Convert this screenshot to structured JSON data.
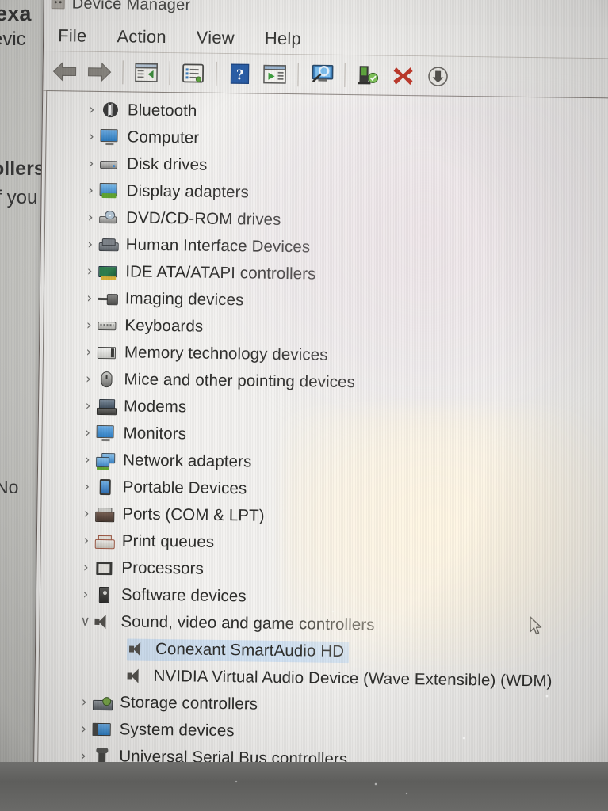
{
  "window": {
    "title": "Device Manager",
    "app_icon": "device-manager-icon"
  },
  "menubar": {
    "items": [
      {
        "label": "File",
        "name": "menu-file"
      },
      {
        "label": "Action",
        "name": "menu-action"
      },
      {
        "label": "View",
        "name": "menu-view"
      },
      {
        "label": "Help",
        "name": "menu-help"
      }
    ]
  },
  "toolbar": {
    "buttons": [
      {
        "name": "back-button",
        "icon": "back-arrow-icon",
        "tooltip": "Back"
      },
      {
        "name": "forward-button",
        "icon": "forward-arrow-icon",
        "tooltip": "Forward"
      },
      {
        "name": "show-hide-console-tree-button",
        "icon": "console-tree-icon",
        "tooltip": "Show/Hide Console Tree"
      },
      {
        "name": "properties-button",
        "icon": "properties-icon",
        "tooltip": "Properties"
      },
      {
        "name": "help-button",
        "icon": "help-question-icon",
        "tooltip": "Help"
      },
      {
        "name": "update-driver-button",
        "icon": "update-driver-icon",
        "tooltip": "Update Driver Software"
      },
      {
        "name": "scan-hardware-button",
        "icon": "scan-hardware-changes-icon",
        "tooltip": "Scan for hardware changes"
      },
      {
        "name": "enable-device-button",
        "icon": "enable-device-icon",
        "tooltip": "Enable device"
      },
      {
        "name": "uninstall-device-button",
        "icon": "uninstall-red-x-icon",
        "tooltip": "Uninstall device"
      },
      {
        "name": "disable-device-button",
        "icon": "disable-device-down-arrow-icon",
        "tooltip": "Disable device"
      }
    ]
  },
  "tree": {
    "selected": "Conexant SmartAudio HD",
    "nodes": [
      {
        "label": "Bluetooth",
        "icon": "bluetooth-icon",
        "state": "collapsed",
        "level": 1
      },
      {
        "label": "Computer",
        "icon": "computer-icon",
        "state": "collapsed",
        "level": 1
      },
      {
        "label": "Disk drives",
        "icon": "disk-drive-icon",
        "state": "collapsed",
        "level": 1
      },
      {
        "label": "Display adapters",
        "icon": "display-adapter-icon",
        "state": "collapsed",
        "level": 1
      },
      {
        "label": "DVD/CD-ROM drives",
        "icon": "dvd-drive-icon",
        "state": "collapsed",
        "level": 1
      },
      {
        "label": "Human Interface Devices",
        "icon": "hid-icon",
        "state": "collapsed",
        "level": 1
      },
      {
        "label": "IDE ATA/ATAPI controllers",
        "icon": "ide-controller-icon",
        "state": "collapsed",
        "level": 1
      },
      {
        "label": "Imaging devices",
        "icon": "imaging-device-icon",
        "state": "collapsed",
        "level": 1
      },
      {
        "label": "Keyboards",
        "icon": "keyboard-icon",
        "state": "collapsed",
        "level": 1
      },
      {
        "label": "Memory technology devices",
        "icon": "memory-device-icon",
        "state": "collapsed",
        "level": 1
      },
      {
        "label": "Mice and other pointing devices",
        "icon": "mouse-icon",
        "state": "collapsed",
        "level": 1
      },
      {
        "label": "Modems",
        "icon": "modem-icon",
        "state": "collapsed",
        "level": 1
      },
      {
        "label": "Monitors",
        "icon": "monitor-icon",
        "state": "collapsed",
        "level": 1
      },
      {
        "label": "Network adapters",
        "icon": "network-adapter-icon",
        "state": "collapsed",
        "level": 1
      },
      {
        "label": "Portable Devices",
        "icon": "portable-device-icon",
        "state": "collapsed",
        "level": 1
      },
      {
        "label": "Ports (COM & LPT)",
        "icon": "ports-icon",
        "state": "collapsed",
        "level": 1
      },
      {
        "label": "Print queues",
        "icon": "print-queue-icon",
        "state": "collapsed",
        "level": 1
      },
      {
        "label": "Processors",
        "icon": "processor-icon",
        "state": "collapsed",
        "level": 1
      },
      {
        "label": "Software devices",
        "icon": "software-device-icon",
        "state": "collapsed",
        "level": 1
      },
      {
        "label": "Sound, video and game controllers",
        "icon": "sound-controller-icon",
        "state": "expanded",
        "level": 1
      },
      {
        "label": "Conexant SmartAudio HD",
        "icon": "sound-device-icon",
        "state": "leaf",
        "level": 2,
        "selected": true
      },
      {
        "label": "NVIDIA Virtual Audio Device (Wave Extensible) (WDM)",
        "icon": "sound-device-icon",
        "state": "leaf",
        "level": 2
      },
      {
        "label": "Storage controllers",
        "icon": "storage-controller-icon",
        "state": "collapsed",
        "level": 1
      },
      {
        "label": "System devices",
        "icon": "system-device-icon",
        "state": "collapsed",
        "level": 1
      },
      {
        "label": "Universal Serial Bus controllers",
        "icon": "usb-controller-icon",
        "state": "collapsed",
        "level": 1
      }
    ],
    "twisty_collapsed": "›",
    "twisty_expanded": "∨"
  },
  "background_page": {
    "fragments": [
      {
        "text": "exa",
        "name": "background-text-exa"
      },
      {
        "text": "evic",
        "name": "background-text-evic"
      },
      {
        "text": "ollers",
        "name": "background-text-ollers"
      },
      {
        "text": "if you",
        "name": "background-text-ifyou"
      },
      {
        "text": "No",
        "name": "background-text-no"
      }
    ]
  },
  "cursor": {
    "icon": "mouse-pointer-icon"
  },
  "colors": {
    "selection": "#d2e2f3",
    "window_chrome": "#f1f0ee",
    "uninstall_red": "#c0392b",
    "text": "#2e2e2c"
  }
}
